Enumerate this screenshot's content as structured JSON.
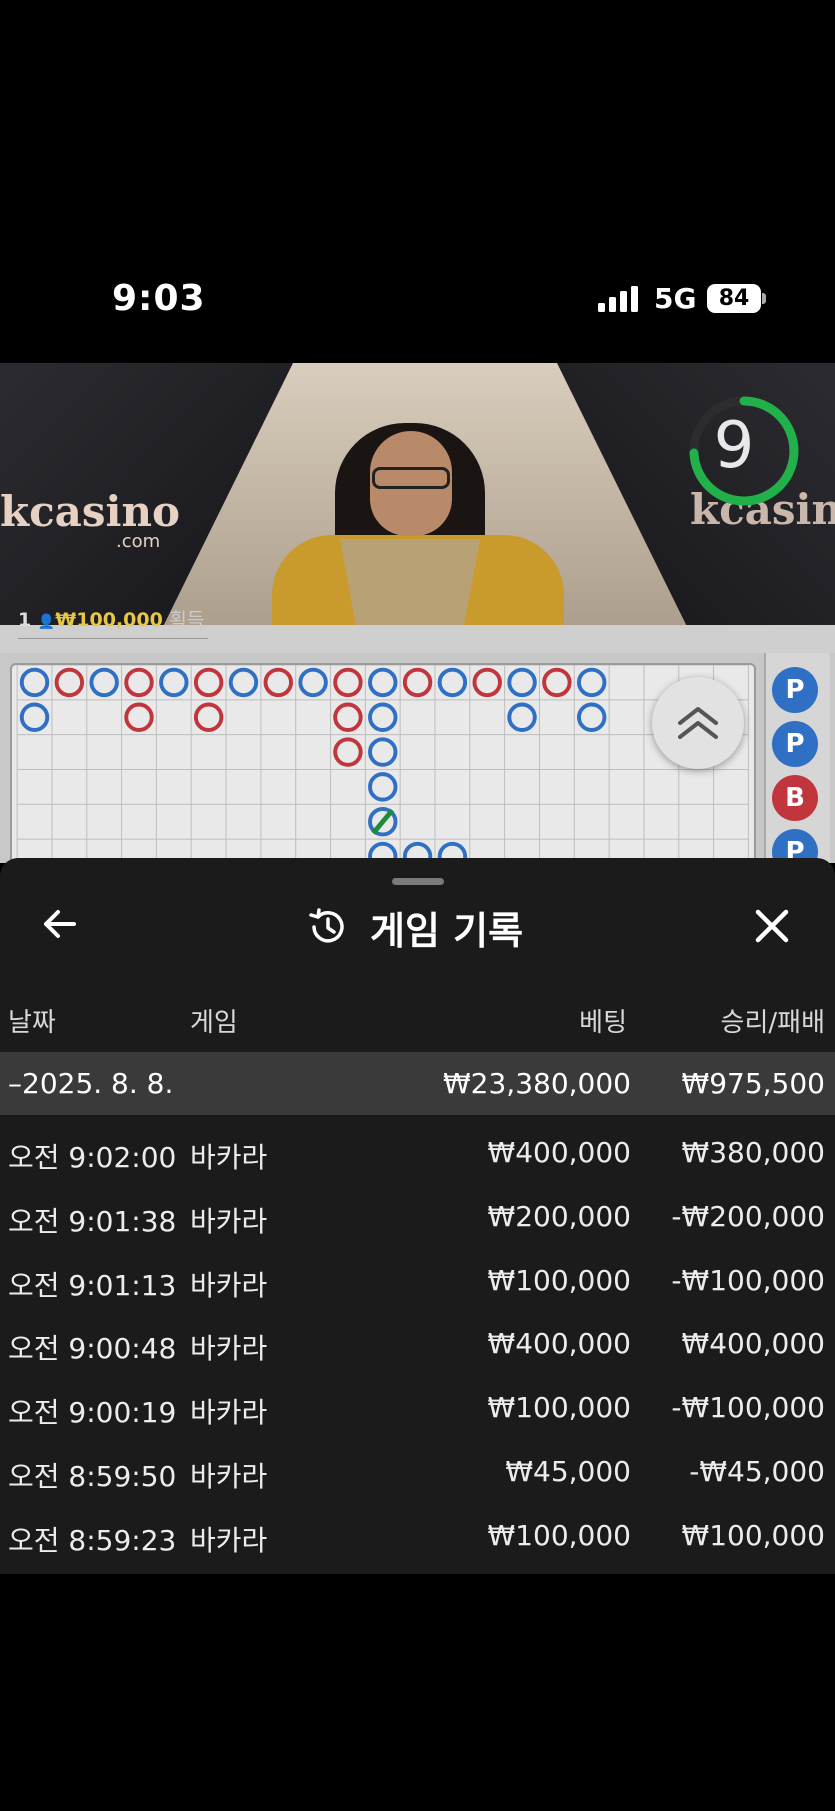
{
  "status_bar": {
    "time": "9:03",
    "network": "5G",
    "battery": "84"
  },
  "video": {
    "logo_text": "kcasino",
    "logo_sub": ".com",
    "logo_text_right": "kcasin",
    "countdown": "9",
    "win_banner": {
      "player_count": "1",
      "amount": "₩100,000",
      "label": "획득"
    }
  },
  "scoreboard": {
    "bead_items": [
      "P",
      "P",
      "B",
      "P"
    ]
  },
  "history_sheet": {
    "title": "게임 기록",
    "columns": {
      "date": "날짜",
      "game": "게임",
      "bet": "베팅",
      "result": "승리/패배"
    },
    "summary": {
      "date": "–2025. 8. 8.",
      "bet_total": "₩23,380,000",
      "result_total": "₩975,500"
    },
    "rows": [
      {
        "time": "오전 9:02:00",
        "game": "바카라",
        "bet": "₩400,000",
        "result": "₩380,000"
      },
      {
        "time": "오전 9:01:38",
        "game": "바카라",
        "bet": "₩200,000",
        "result": "-₩200,000"
      },
      {
        "time": "오전 9:01:13",
        "game": "바카라",
        "bet": "₩100,000",
        "result": "-₩100,000"
      },
      {
        "time": "오전 9:00:48",
        "game": "바카라",
        "bet": "₩400,000",
        "result": "₩400,000"
      },
      {
        "time": "오전 9:00:19",
        "game": "바카라",
        "bet": "₩100,000",
        "result": "-₩100,000"
      },
      {
        "time": "오전 8:59:50",
        "game": "바카라",
        "bet": "₩45,000",
        "result": "-₩45,000"
      },
      {
        "time": "오전 8:59:23",
        "game": "바카라",
        "bet": "₩100,000",
        "result": "₩100,000"
      }
    ]
  },
  "colors": {
    "player": "#2f6fc4",
    "banker": "#c0363c",
    "tie": "#1f8a3c",
    "timer": "#22b04a",
    "win_amount": "#e6c845"
  }
}
